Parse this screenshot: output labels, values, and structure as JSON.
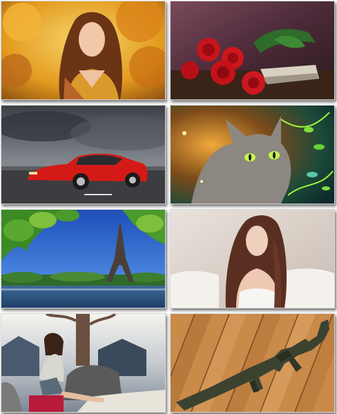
{
  "gallery": {
    "tiles": [
      {
        "subject": "woman-autumn-leaves"
      },
      {
        "subject": "red-roses-book"
      },
      {
        "subject": "red-sports-car"
      },
      {
        "subject": "fantasy-cat-glowing-eyes"
      },
      {
        "subject": "eiffel-tower-river"
      },
      {
        "subject": "woman-white-couch"
      },
      {
        "subject": "woman-sitting-outdoors"
      },
      {
        "subject": "rifle-on-wooden-planks"
      }
    ]
  }
}
